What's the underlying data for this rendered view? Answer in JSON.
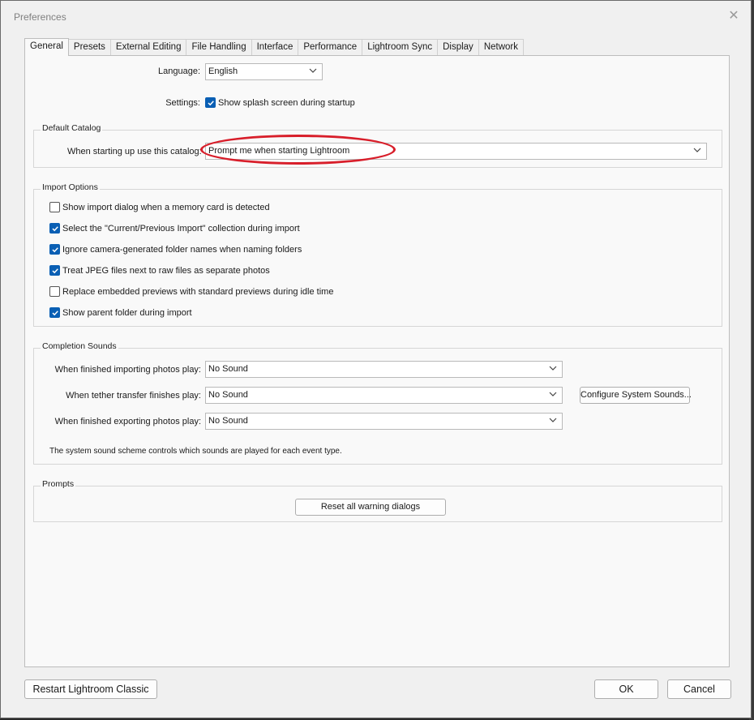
{
  "window": {
    "title": "Preferences"
  },
  "tabs": [
    "General",
    "Presets",
    "External Editing",
    "File Handling",
    "Interface",
    "Performance",
    "Lightroom Sync",
    "Display",
    "Network"
  ],
  "general": {
    "language_label": "Language:",
    "language_value": "English",
    "settings_label": "Settings:",
    "splash_label": "Show splash screen during startup",
    "splash_checked": true
  },
  "default_catalog": {
    "title": "Default Catalog",
    "label": "When starting up use this catalog:",
    "value": "Prompt me when starting Lightroom",
    "annotation_color": "#d81e2a"
  },
  "import_options": {
    "title": "Import Options",
    "items": [
      {
        "label": "Show import dialog when a memory card is detected",
        "checked": false
      },
      {
        "label": "Select the \"Current/Previous Import\" collection during import",
        "checked": true
      },
      {
        "label": "Ignore camera-generated folder names when naming folders",
        "checked": true
      },
      {
        "label": "Treat JPEG files next to raw files as separate photos",
        "checked": true
      },
      {
        "label": "Replace embedded previews with standard previews during idle time",
        "checked": false
      },
      {
        "label": "Show parent folder during import",
        "checked": true
      }
    ]
  },
  "completion_sounds": {
    "title": "Completion Sounds",
    "rows": [
      {
        "label": "When finished importing photos play:",
        "value": "No Sound"
      },
      {
        "label": "When tether transfer finishes play:",
        "value": "No Sound"
      },
      {
        "label": "When finished exporting photos play:",
        "value": "No Sound"
      }
    ],
    "configure_button": "Configure System Sounds...",
    "note": "The system sound scheme controls which sounds are played for each event type."
  },
  "prompts": {
    "title": "Prompts",
    "reset_button": "Reset all warning dialogs"
  },
  "footer": {
    "restart_button": "Restart Lightroom Classic",
    "ok_button": "OK",
    "cancel_button": "Cancel"
  },
  "colors": {
    "checkbox_accent": "#0a5fb4"
  }
}
